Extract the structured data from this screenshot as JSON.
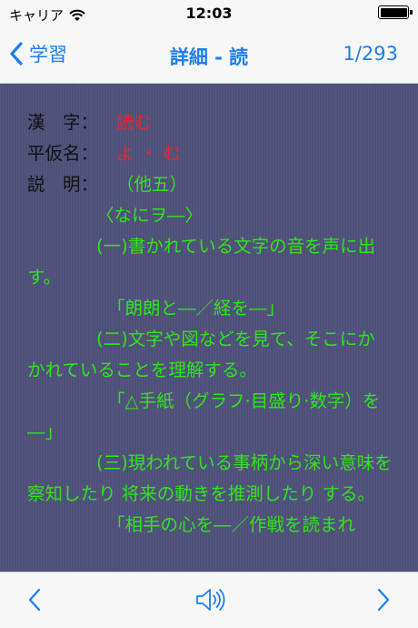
{
  "status_bar": {
    "carrier": "キャリア",
    "time": "12:03"
  },
  "nav": {
    "back_label": "学習",
    "title": "詳細 - 読",
    "counter": "1/293"
  },
  "entry": {
    "kanji_label": "漢　字：",
    "kanji_value": "読む",
    "kana_label": "平仮名：",
    "kana_value": "よ ・ む",
    "meaning_label": "説　明：",
    "meaning_type": "（他五）",
    "lines": [
      "〈なにヲ―〉",
      "(一)書かれている文字の音を声に出す。",
      "「朗朗と―／経を―」",
      "(二)文字や図などを見て、そこにかかれていることを理解する。",
      "「△手紙（グラフ·目盛り·数字）を―」",
      "(三)現われている事柄から深い意味を察知したり 将来の動きを推測したり する。",
      "「相手の心を―／作戦を読まれ"
    ]
  },
  "colors": {
    "accent": "#1a7ef0",
    "content_bg": "#4f5079",
    "value_red": "#e8242a",
    "text_green": "#2ee41c"
  },
  "icons": {
    "back": "chevron-left-icon",
    "prev": "chevron-left-icon",
    "sound": "speaker-icon",
    "next": "chevron-right-icon"
  }
}
